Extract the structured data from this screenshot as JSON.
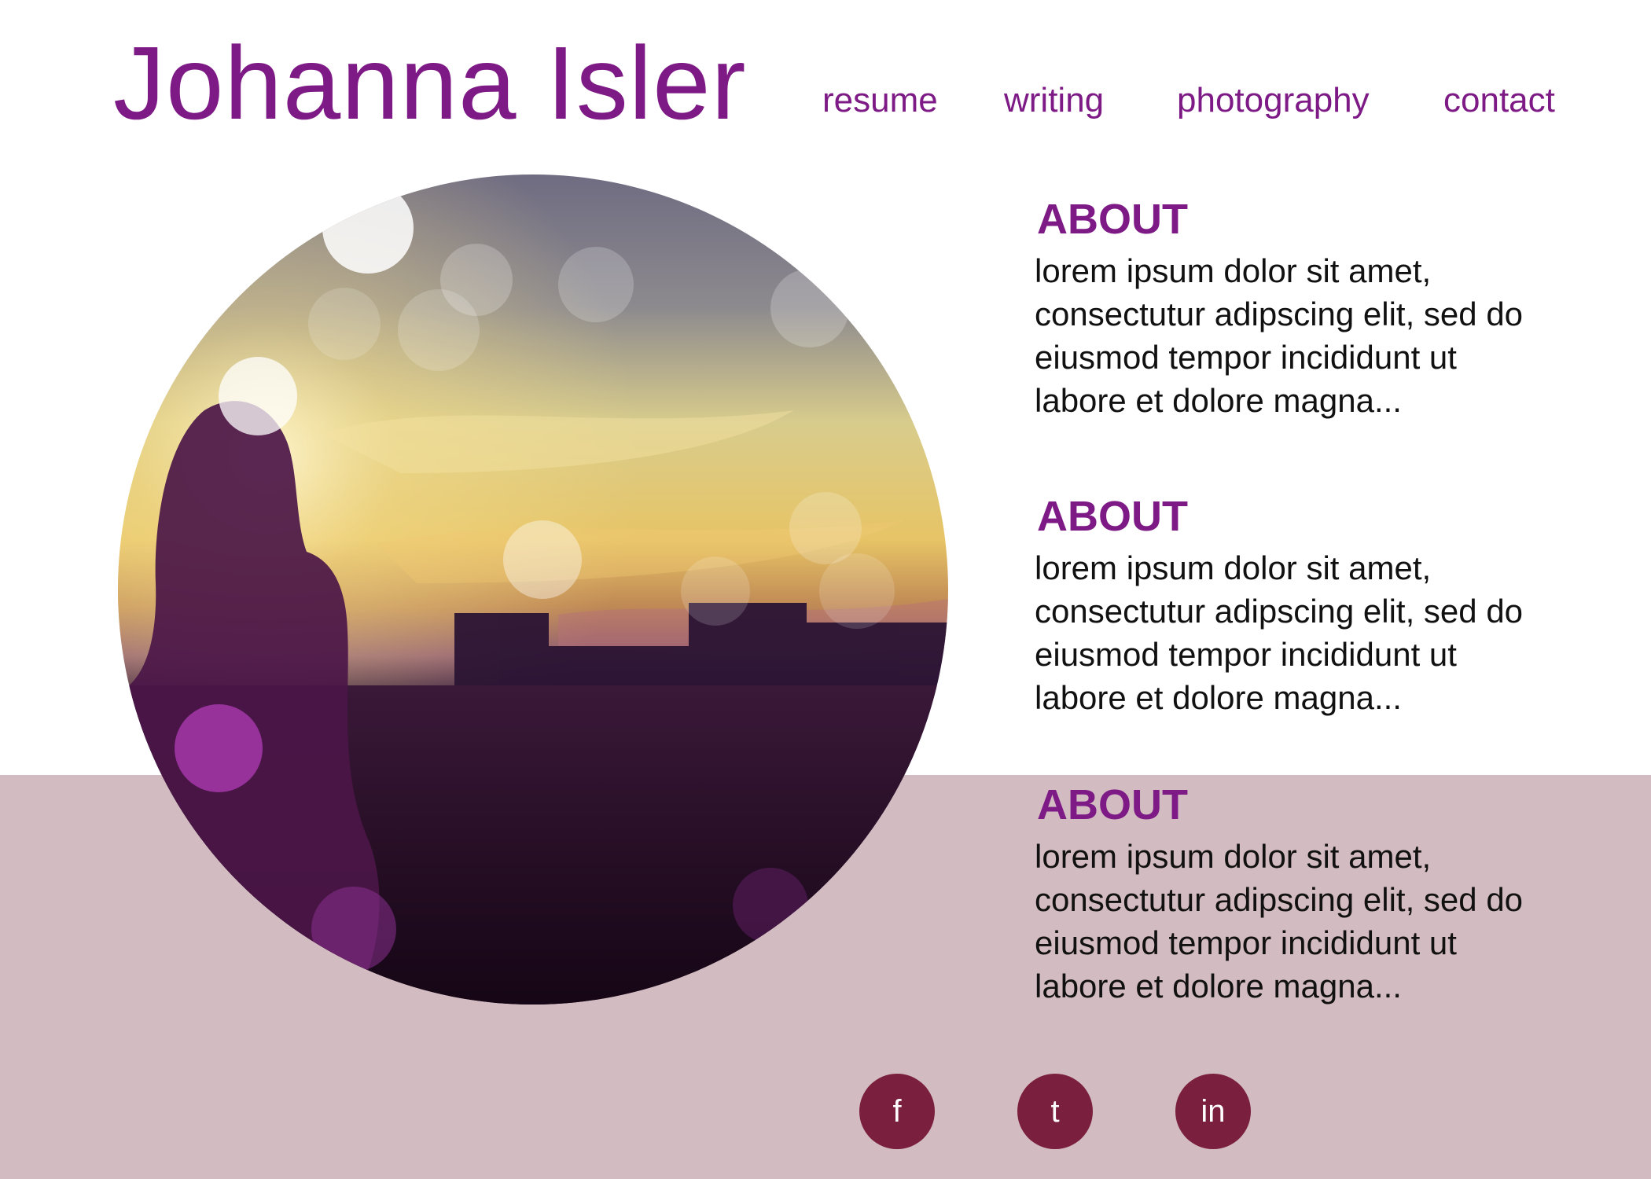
{
  "header": {
    "title": "Johanna Isler",
    "nav": [
      {
        "label": "resume"
      },
      {
        "label": "writing"
      },
      {
        "label": "photography"
      },
      {
        "label": "contact"
      }
    ]
  },
  "sections": [
    {
      "heading": "ABOUT",
      "body": "lorem ipsum dolor sit amet, consectutur adipscing elit, sed do eiusmod tempor incididunt ut labore et dolore magna..."
    },
    {
      "heading": "ABOUT",
      "body": "lorem ipsum dolor sit amet, consectutur adipscing elit, sed do eiusmod tempor incididunt ut labore et dolore magna..."
    },
    {
      "heading": "ABOUT",
      "body": "lorem ipsum dolor sit amet, consectutur adipscing elit, sed do eiusmod tempor incididunt ut labore et dolore magna..."
    }
  ],
  "social": [
    {
      "label": "f",
      "icon": "facebook-icon"
    },
    {
      "label": "t",
      "icon": "twitter-icon"
    },
    {
      "label": "in",
      "icon": "linkedin-icon"
    }
  ],
  "colors": {
    "accent": "#7d1a85",
    "band": "#d3bbc2",
    "social_button": "#7a1f3d",
    "body_text": "#111111"
  }
}
